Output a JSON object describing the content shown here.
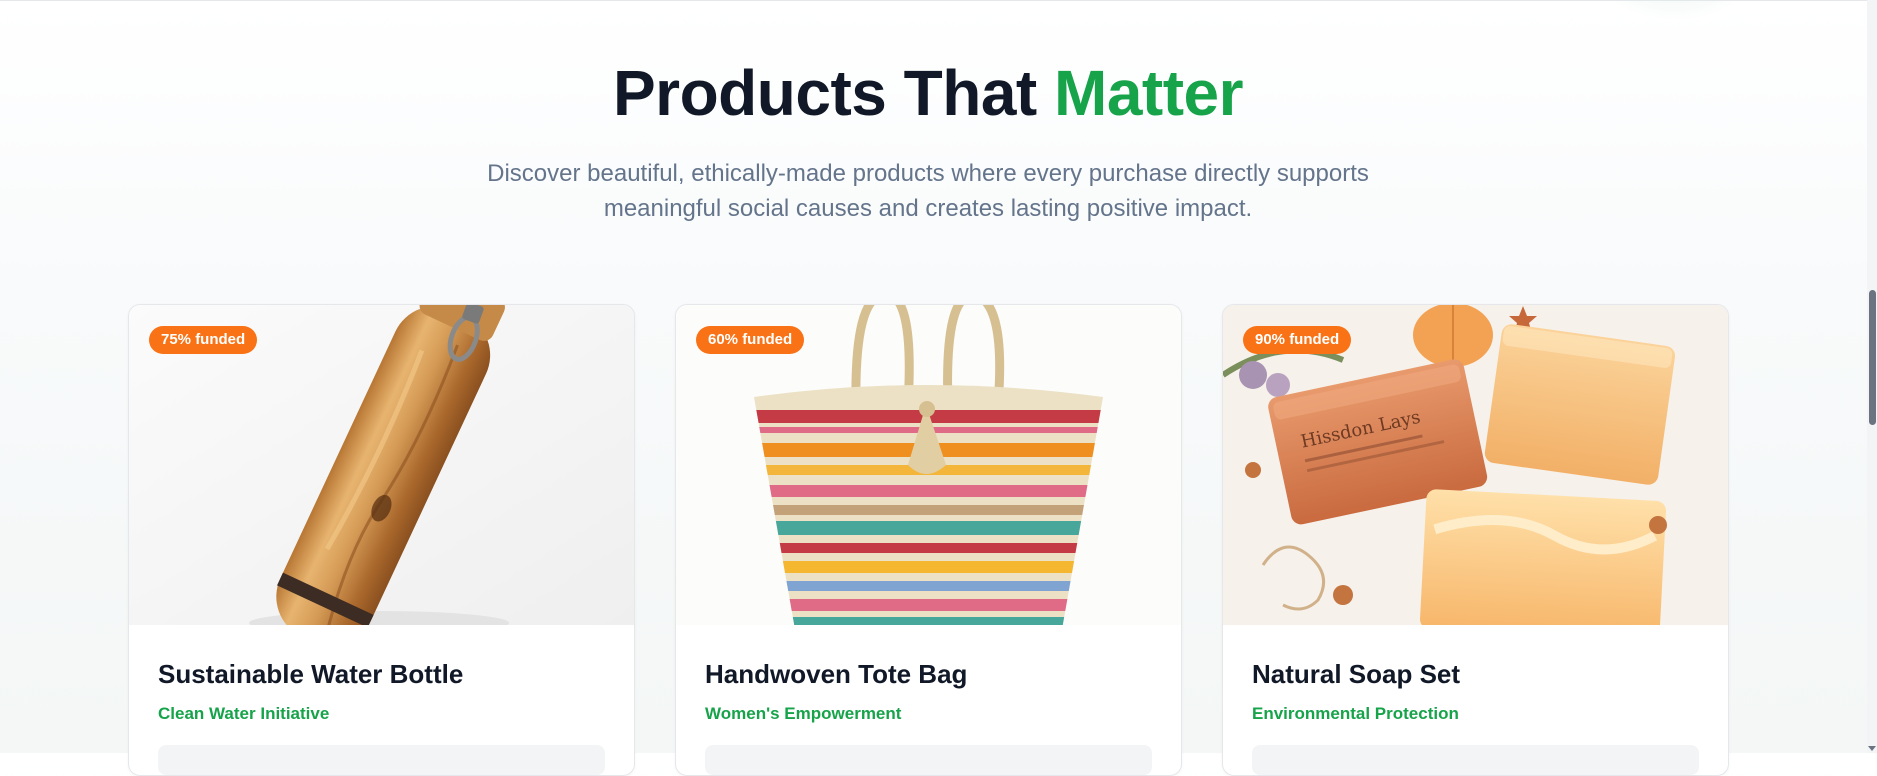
{
  "section": {
    "title_main": "Products That ",
    "title_accent": "Matter",
    "subtitle": "Discover beautiful, ethically-made products where every purchase directly supports meaningful social causes and creates lasting positive impact."
  },
  "theme": {
    "accent": "#16a34a",
    "badge": "#f97316",
    "text": "#111827",
    "muted": "#64748b"
  },
  "products": [
    {
      "badge": "75% funded",
      "funded_percent": 75,
      "name": "Sustainable Water Bottle",
      "cause": "Clean Water Initiative",
      "image_icon": "wooden-water-bottle-photo"
    },
    {
      "badge": "60% funded",
      "funded_percent": 60,
      "name": "Handwoven Tote Bag",
      "cause": "Women's Empowerment",
      "image_icon": "striped-tote-bag-photo"
    },
    {
      "badge": "90% funded",
      "funded_percent": 90,
      "name": "Natural Soap Set",
      "cause": "Environmental Protection",
      "image_icon": "soap-bars-photo",
      "image_text": "Hissdon Lays"
    }
  ]
}
